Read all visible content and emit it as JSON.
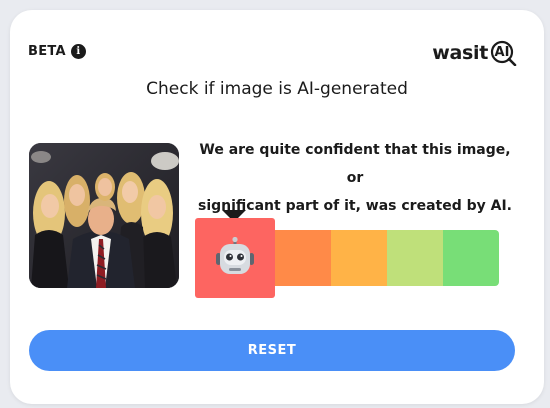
{
  "header": {
    "beta_label": "BETA",
    "info_icon": "info-icon",
    "logo_text": "wasit",
    "logo_ai": "AI"
  },
  "subtitle": "Check if image is AI-generated",
  "image": {
    "description_icon": "uploaded-photo"
  },
  "result": {
    "line1": "We are quite confident that this image, or",
    "line2": "significant part of it, was created by AI.",
    "indicator_icon": "robot-icon"
  },
  "scale": {
    "colors": [
      "#fd6561",
      "#ff8a48",
      "#ffb347",
      "#bfe07a",
      "#78de77"
    ],
    "selected_index": 0
  },
  "reset_button": {
    "label": "RESET",
    "color": "#4a8ff7"
  }
}
